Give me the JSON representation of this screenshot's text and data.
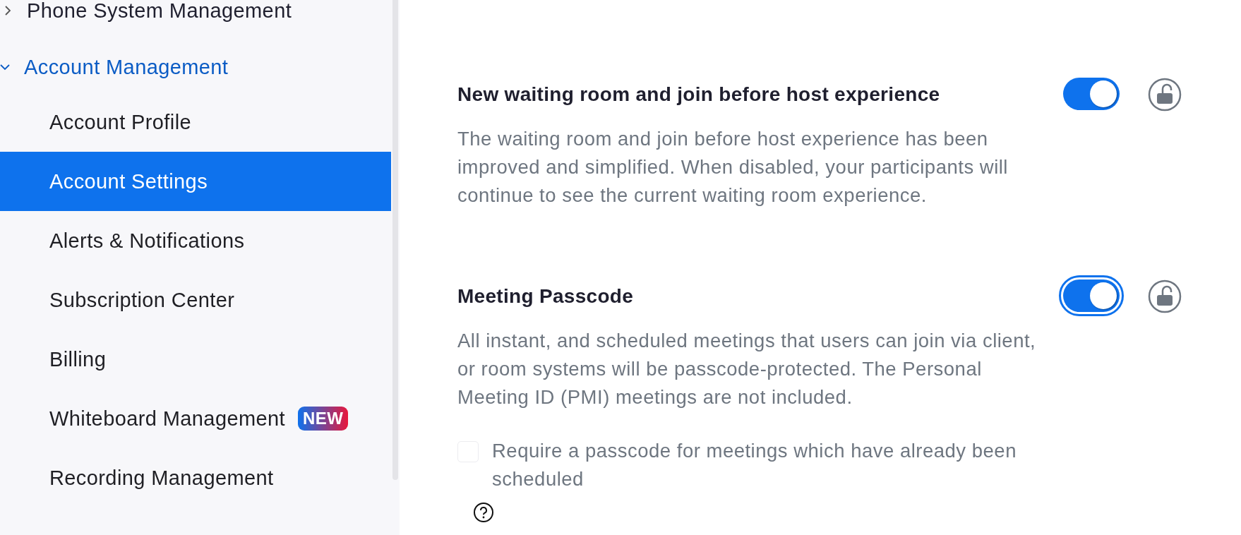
{
  "sidebar": {
    "groups": [
      {
        "label": "Phone System Management",
        "expanded": false
      },
      {
        "label": "Account Management",
        "expanded": true,
        "children": [
          {
            "label": "Account Profile",
            "selected": false
          },
          {
            "label": "Account Settings",
            "selected": true
          },
          {
            "label": "Alerts & Notifications",
            "selected": false
          },
          {
            "label": "Subscription Center",
            "selected": false
          },
          {
            "label": "Billing",
            "selected": false
          },
          {
            "label": "Whiteboard Management",
            "selected": false,
            "badge": "NEW"
          },
          {
            "label": "Recording Management",
            "selected": false
          }
        ]
      }
    ]
  },
  "settings": [
    {
      "title": "New waiting room and join before host experience",
      "on": true,
      "focused": false,
      "locked": false,
      "description": "The waiting room and join before host experience has been improved and simplified. When disabled, your participants will continue to see the current waiting room experience."
    },
    {
      "title": "Meeting Passcode",
      "on": true,
      "focused": true,
      "locked": false,
      "description": "All instant, and scheduled meetings that users can join via client, or room systems will be passcode-protected. The Personal Meeting ID (PMI) meetings are not included.",
      "options": [
        {
          "label": "Require a passcode for meetings which have already been scheduled",
          "checked": false,
          "disabled": true
        }
      ],
      "help": true
    }
  ]
}
